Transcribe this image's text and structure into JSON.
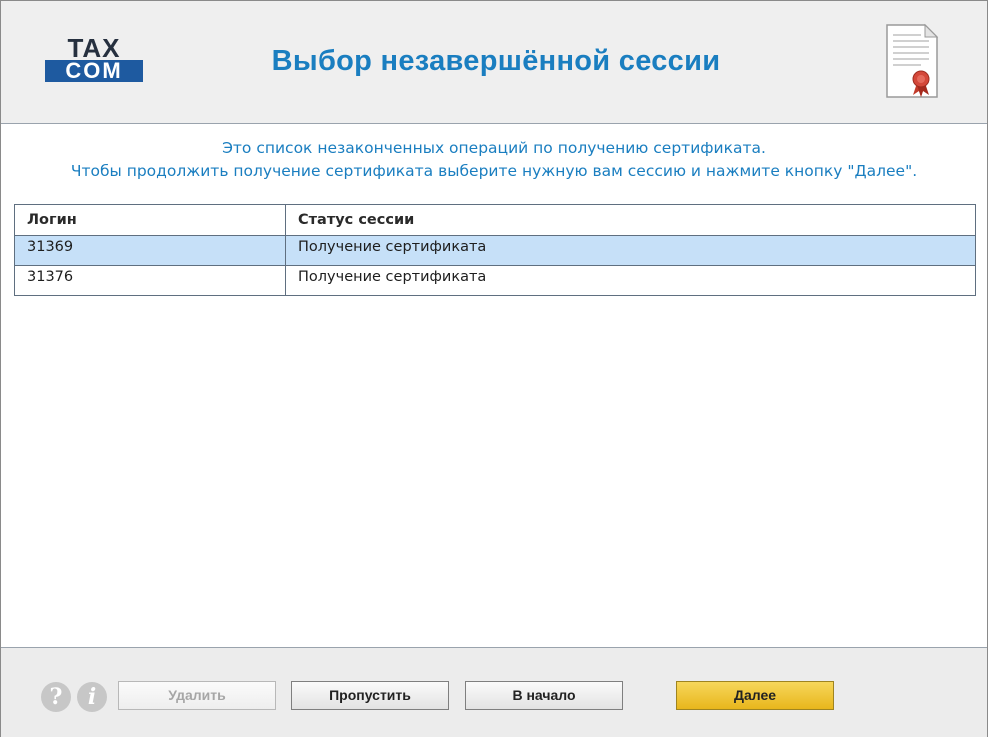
{
  "header": {
    "logo_top": "TAX",
    "logo_bottom": "COM",
    "title": "Выбор незавершённой сессии",
    "icon": "certificate-document-icon"
  },
  "info": {
    "line1": "Это список незаконченных операций по получению сертификата.",
    "line2": "Чтобы продолжить получение сертификата выберите нужную вам сессию и нажмите кнопку \"Далее\"."
  },
  "table": {
    "columns": [
      "Логин",
      "Статус сессии"
    ],
    "rows": [
      {
        "login": "31369",
        "status": "Получение сертификата",
        "selected": true
      },
      {
        "login": "31376",
        "status": "Получение сертификата",
        "selected": false
      }
    ]
  },
  "footer": {
    "help_icon": "?",
    "info_icon": "i",
    "delete_label": "Удалить",
    "skip_label": "Пропустить",
    "start_label": "В начало",
    "next_label": "Далее"
  },
  "colors": {
    "accent": "#1a7ec0",
    "logo_blue": "#1e5aa0",
    "selection": "#c6e0f8",
    "primary_button": "#e8b61c"
  }
}
